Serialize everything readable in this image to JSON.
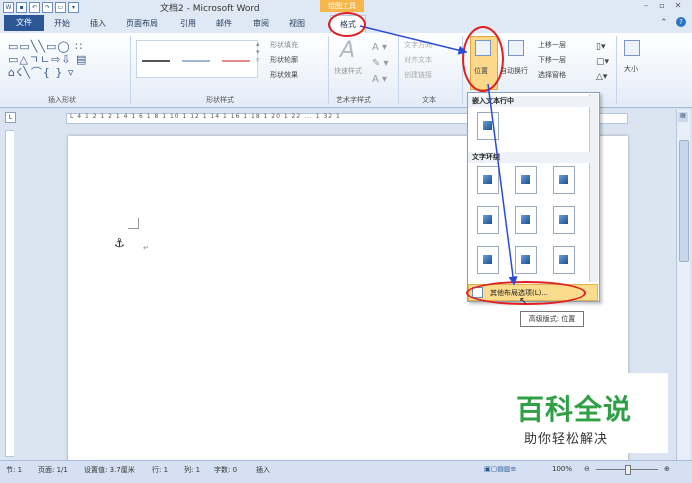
{
  "window": {
    "title": "文档2 - Microsoft Word",
    "context_tab_group": "绘图工具"
  },
  "tabs": {
    "file": "文件",
    "items": [
      "开始",
      "插入",
      "页面布局",
      "引用",
      "邮件",
      "审阅",
      "视图"
    ],
    "format": "格式"
  },
  "ribbon": {
    "groups": {
      "insert_shapes": "插入形状",
      "shape_styles": "形状样式",
      "wordart_styles": "艺术字样式",
      "text": "文本"
    },
    "shape_fill": "形状填充",
    "shape_outline": "形状轮廓",
    "shape_effects": "形状效果",
    "quick_styles": "快速样式",
    "text_direction": "文字方向",
    "align_text": "对齐文本",
    "create_link": "创建链接",
    "position": "位置",
    "auto_wrap": "自动换行",
    "bring_forward": "上移一层",
    "send_backward": "下移一层",
    "selection_pane": "选择窗格",
    "size": "大小"
  },
  "dropdown": {
    "inline_header": "嵌入文本行中",
    "wrap_header": "文字环绕",
    "more_options": "其他布局选项(L)...",
    "tooltip": "高级版式: 位置"
  },
  "ruler_text": "L  4  1  2  1     2  1  4  1  6  1  8  1 10  1 12  1 14  1 16  1 18  1 20  1 22 ...   1 32 1",
  "status": {
    "page": "节: 1",
    "pages": "页面: 1/1",
    "setting": "设置值: 3.7厘米",
    "row": "行: 1",
    "col": "列: 1",
    "words": "字数: 0",
    "insert": "插入",
    "zoom": "100%"
  },
  "watermark": {
    "title": "百科全说",
    "subtitle": "助你轻松解决"
  },
  "colors": {
    "accent": "#2b5797",
    "highlight_ring": "#e02020",
    "arrow": "#2a4bd8",
    "watermark_green": "#2fa046"
  }
}
